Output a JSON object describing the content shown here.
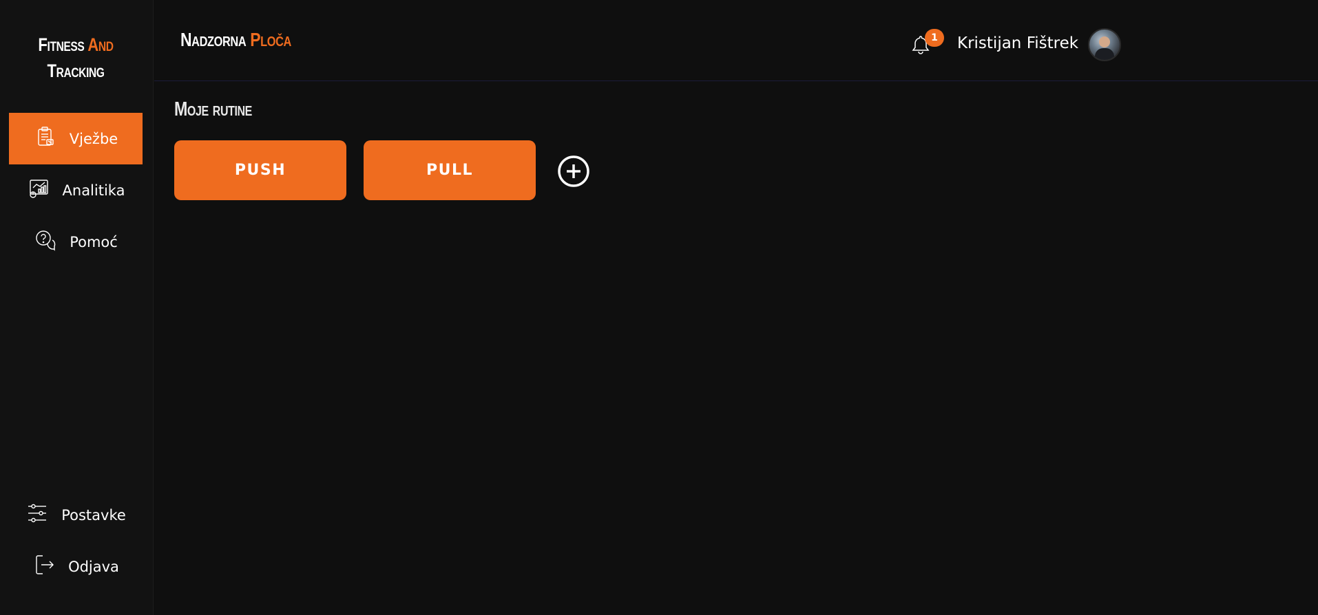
{
  "sidebar": {
    "logo": {
      "line1_a": "Fitness",
      "line1_b": "And",
      "line2": "Tracking"
    },
    "items": [
      {
        "label": "Vježbe",
        "icon": "clipboard-exercise-icon",
        "active": true
      },
      {
        "label": "Analitika",
        "icon": "analytics-chart-icon",
        "active": false
      },
      {
        "label": "Pomoć",
        "icon": "help-chat-icon",
        "active": false
      }
    ],
    "bottom_items": [
      {
        "label": "Postavke",
        "icon": "sliders-icon"
      },
      {
        "label": "Odjava",
        "icon": "logout-icon"
      }
    ]
  },
  "header": {
    "title_a": "Nadzorna",
    "title_b": "Ploča",
    "notification_count": "1",
    "user_name": "Kristijan Fištrek"
  },
  "main": {
    "section_title": "Moje rutine",
    "routines": [
      {
        "label": "PUSH"
      },
      {
        "label": "PULL"
      }
    ]
  },
  "colors": {
    "accent": "#ef6c1f",
    "background": "#0f0f0f",
    "sidebar": "#121212",
    "text": "#ffffff"
  }
}
